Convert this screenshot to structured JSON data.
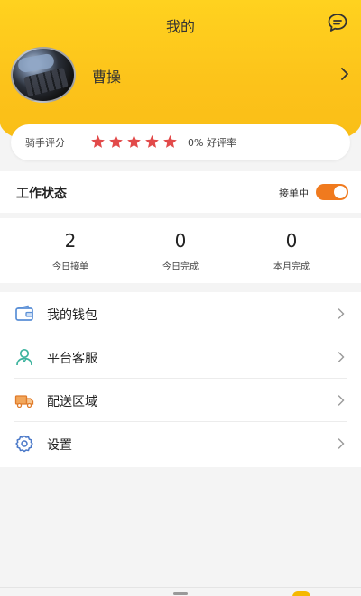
{
  "header": {
    "title": "我的",
    "message_icon": "message-icon",
    "accent_color": "#fcc21a"
  },
  "profile": {
    "username": "曹操",
    "avatar": "avatar"
  },
  "rating": {
    "label": "骑手评分",
    "stars": 5,
    "star_color": "#e24a4a",
    "rate_text": "0% 好评率"
  },
  "work_status": {
    "title": "工作状态",
    "accept_label": "接单中",
    "toggle_on": true,
    "toggle_color": "#f07a1e"
  },
  "stats": [
    {
      "value": "2",
      "label": "今日接单"
    },
    {
      "value": "0",
      "label": "今日完成"
    },
    {
      "value": "0",
      "label": "本月完成"
    }
  ],
  "menu": [
    {
      "label": "我的钱包",
      "icon": "wallet-icon"
    },
    {
      "label": "平台客服",
      "icon": "customer-service-icon"
    },
    {
      "label": "配送区域",
      "icon": "delivery-truck-icon"
    },
    {
      "label": "设置",
      "icon": "settings-gear-icon"
    }
  ]
}
